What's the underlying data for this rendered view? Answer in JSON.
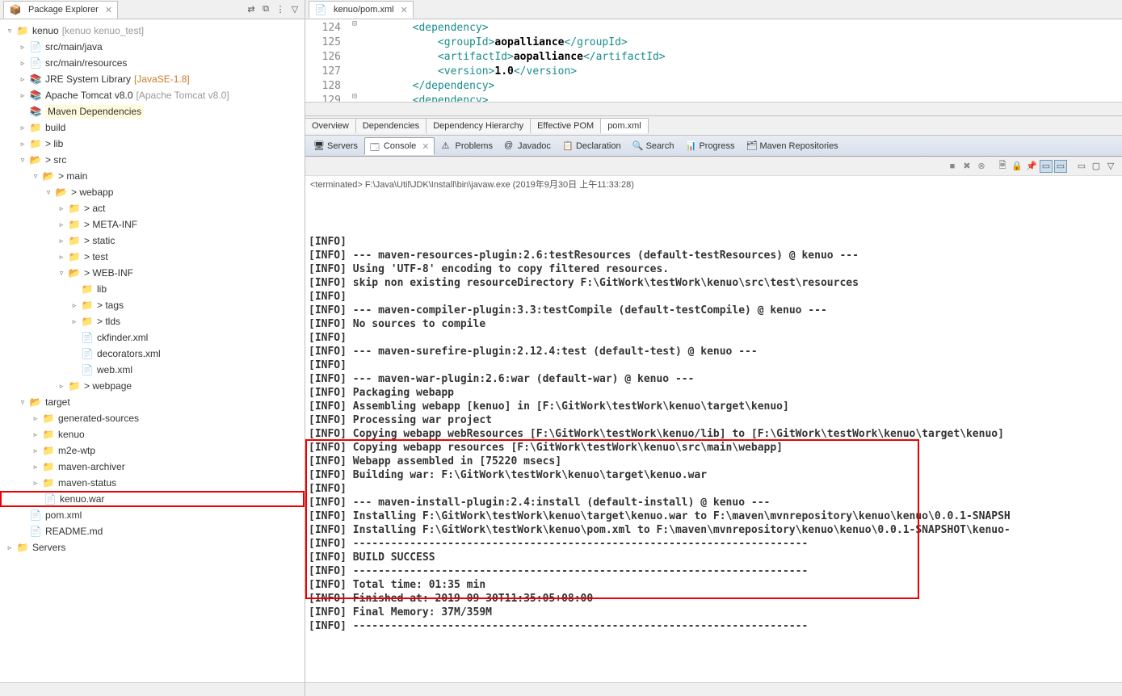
{
  "package_explorer": {
    "title": "Package Explorer",
    "project": {
      "name": "kenuo",
      "extra": "[kenuo kenuo_test]"
    },
    "nodes": {
      "src_main_java": "src/main/java",
      "src_main_resources": "src/main/resources",
      "jre": "JRE System Library",
      "jre_extra": "[JavaSE-1.8]",
      "tomcat": "Apache Tomcat v8.0",
      "tomcat_extra": "[Apache Tomcat v8.0]",
      "maven_deps": "Maven Dependencies",
      "build": "build",
      "lib": "> lib",
      "src": "> src",
      "main": "> main",
      "webapp": "> webapp",
      "act": "> act",
      "meta_inf": "> META-INF",
      "static": "> static",
      "test": "> test",
      "web_inf": "> WEB-INF",
      "lib2": "lib",
      "tags": "> tags",
      "tlds": "> tlds",
      "ckfinder": "ckfinder.xml",
      "decorators": "decorators.xml",
      "webxml": "web.xml",
      "webpage": "> webpage",
      "target": "target",
      "generated_sources": "generated-sources",
      "kenuo": "kenuo",
      "m2e_wtp": "m2e-wtp",
      "maven_archiver": "maven-archiver",
      "maven_status": "maven-status",
      "kenuo_war": "kenuo.war",
      "pom": "pom.xml",
      "readme": "README.md",
      "servers": "Servers"
    }
  },
  "editor": {
    "tab": "kenuo/pom.xml",
    "lines": {
      "l124": "124",
      "l125": "125",
      "l126": "126",
      "l127": "127",
      "l128": "128",
      "l129": "129"
    },
    "code": {
      "c124_p": "        ",
      "c124_t": "<dependency>",
      "c125_p": "            ",
      "c125_t1": "<groupId>",
      "c125_v": "aopalliance",
      "c125_t2": "</groupId>",
      "c126_p": "            ",
      "c126_t1": "<artifactId>",
      "c126_v": "aopalliance",
      "c126_t2": "</artifactId>",
      "c127_p": "            ",
      "c127_t1": "<version>",
      "c127_v": "1.0",
      "c127_t2": "</version>",
      "c128_p": "        ",
      "c128_t": "</dependency>",
      "c129_p": "        ",
      "c129_t": "<dependency>"
    },
    "bottom_tabs": [
      "Overview",
      "Dependencies",
      "Dependency Hierarchy",
      "Effective POM",
      "pom.xml"
    ]
  },
  "bottom_tabs": {
    "servers": "Servers",
    "console": "Console",
    "problems": "Problems",
    "javadoc": "Javadoc",
    "declaration": "Declaration",
    "search": "Search",
    "progress": "Progress",
    "maven_repos": "Maven Repositories"
  },
  "console": {
    "status": "<terminated> F:\\Java\\Util\\JDK\\Install\\bin\\javaw.exe (2019年9月30日 上午11:33:28)",
    "lines": [
      "[INFO]",
      "[INFO] --- maven-resources-plugin:2.6:testResources (default-testResources) @ kenuo ---",
      "[INFO] Using 'UTF-8' encoding to copy filtered resources.",
      "[INFO] skip non existing resourceDirectory F:\\GitWork\\testWork\\kenuo\\src\\test\\resources",
      "[INFO]",
      "[INFO] --- maven-compiler-plugin:3.3:testCompile (default-testCompile) @ kenuo ---",
      "[INFO] No sources to compile",
      "[INFO]",
      "[INFO] --- maven-surefire-plugin:2.12.4:test (default-test) @ kenuo ---",
      "[INFO]",
      "[INFO] --- maven-war-plugin:2.6:war (default-war) @ kenuo ---",
      "[INFO] Packaging webapp",
      "[INFO] Assembling webapp [kenuo] in [F:\\GitWork\\testWork\\kenuo\\target\\kenuo]",
      "[INFO] Processing war project",
      "[INFO] Copying webapp webResources [F:\\GitWork\\testWork\\kenuo/lib] to [F:\\GitWork\\testWork\\kenuo\\target\\kenuo]",
      "[INFO] Copying webapp resources [F:\\GitWork\\testWork\\kenuo\\src\\main\\webapp]",
      "[INFO] Webapp assembled in [75220 msecs]",
      "[INFO] Building war: F:\\GitWork\\testWork\\kenuo\\target\\kenuo.war",
      "[INFO]",
      "[INFO] --- maven-install-plugin:2.4:install (default-install) @ kenuo ---",
      "[INFO] Installing F:\\GitWork\\testWork\\kenuo\\target\\kenuo.war to F:\\maven\\mvnrepository\\kenuo\\kenuo\\0.0.1-SNAPSH",
      "[INFO] Installing F:\\GitWork\\testWork\\kenuo\\pom.xml to F:\\maven\\mvnrepository\\kenuo\\kenuo\\0.0.1-SNAPSHOT\\kenuo-",
      "[INFO] ------------------------------------------------------------------------",
      "[INFO] BUILD SUCCESS",
      "[INFO] ------------------------------------------------------------------------",
      "[INFO] Total time: 01:35 min",
      "[INFO] Finished at: 2019-09-30T11:35:05+08:00",
      "[INFO] Final Memory: 37M/359M",
      "[INFO] ------------------------------------------------------------------------"
    ]
  }
}
